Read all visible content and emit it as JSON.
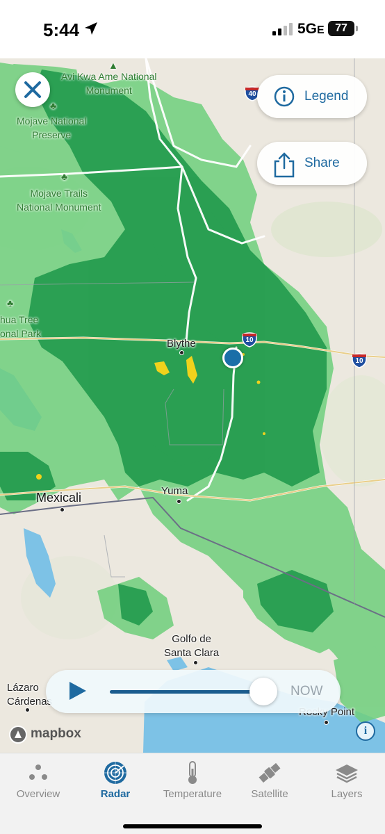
{
  "status": {
    "time": "5:44",
    "network": "5G",
    "network_suffix": "E",
    "battery": "77"
  },
  "map": {
    "places": {
      "avi_kwa_ame": "Avi Kwa Ame National\nMonument",
      "mojave_preserve": "Mojave National\nPreserve",
      "mojave_trails": "Mojave Trails\nNational Monument",
      "joshua_tree": "hua Tree\nonal Park",
      "blythe": "Blythe",
      "mexicali": "Mexicali",
      "yuma": "Yuma",
      "golfo": "Golfo de\nSanta Clara",
      "lazaro": "Lázaro\nCárdenas",
      "rocky_point": "Rocky Point"
    },
    "shields": {
      "i40": "40",
      "i10_a": "10",
      "i10_b": "10"
    }
  },
  "buttons": {
    "legend": "Legend",
    "share": "Share"
  },
  "playback": {
    "now_label": "NOW",
    "progress": 0.92
  },
  "attribution": {
    "mapbox": "mapbox"
  },
  "tabs": [
    {
      "label": "Overview",
      "icon": "overview-icon"
    },
    {
      "label": "Radar",
      "icon": "radar-icon"
    },
    {
      "label": "Temperature",
      "icon": "thermometer-icon"
    },
    {
      "label": "Satellite",
      "icon": "satellite-icon"
    },
    {
      "label": "Layers",
      "icon": "layers-icon"
    }
  ],
  "colors": {
    "accent": "#1f6aa0",
    "radar_green": "#1e9e4a",
    "radar_light": "#6cd07a",
    "radar_yellow": "#f2d21a"
  }
}
